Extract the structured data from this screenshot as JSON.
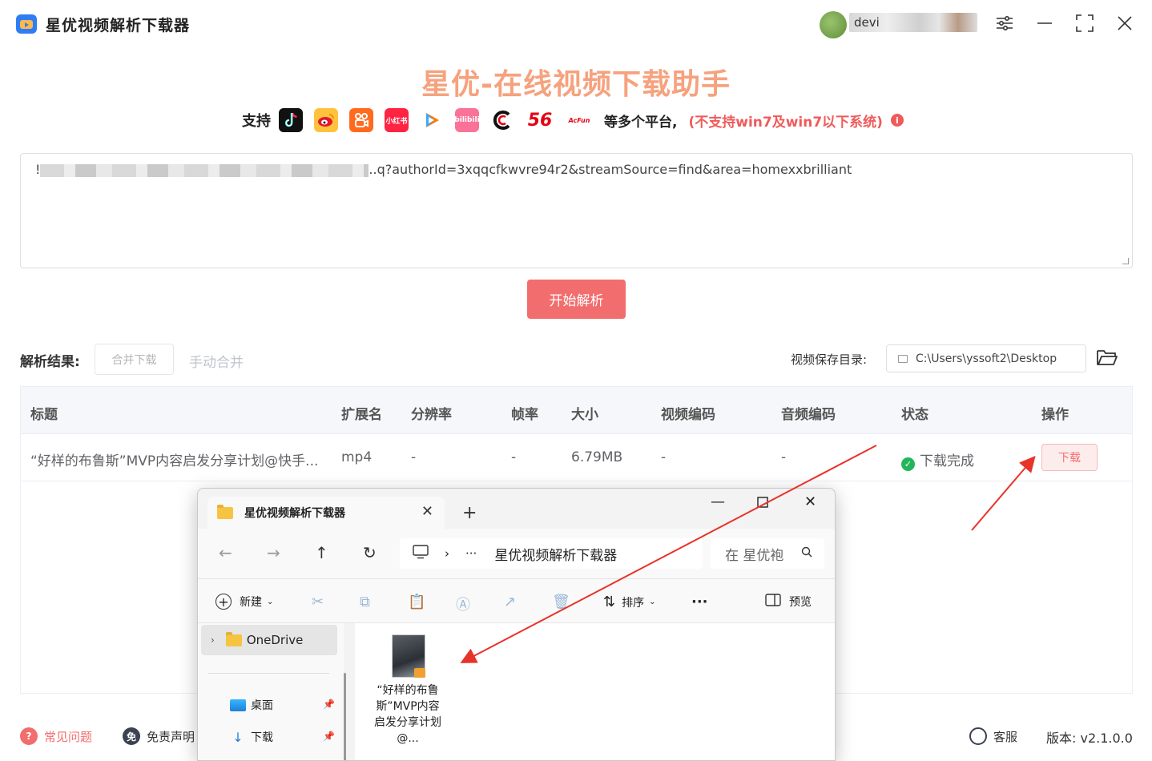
{
  "app": {
    "title": "星优视频解析下载器",
    "user_name": "devi"
  },
  "banner": {
    "title": "星优-在线视频下载助手",
    "support_label": "支持",
    "platforms": [
      "tiktok-icon",
      "weibo-icon",
      "kuaishou-icon",
      "xiaohongshu-icon",
      "tencent-video-icon",
      "bilibili-icon",
      "c-platform-icon",
      "56-icon",
      "acfun-icon"
    ],
    "platform_labels": {
      "xiaohongshu": "小红书",
      "bilibili": "bilibili",
      "fifty_six": "56",
      "acfun": "AcFun"
    },
    "more_text": "等多个平台,",
    "warning_text": "(不支持win7及win7以下系统)",
    "info_glyph": "i"
  },
  "url_input": {
    "visible_prefix": "!",
    "value_suffix": "..q?authorId=3xqqcfkwvre94r2&streamSource=find&area=homexxbrilliant"
  },
  "parse_button": "开始解析",
  "results": {
    "label": "解析结果:",
    "merge_download": "合并下载",
    "manual_merge": "手动合并",
    "save_dir_label": "视频保存目录:",
    "save_dir_value": "C:\\Users\\yssoft2\\Desktop"
  },
  "table": {
    "headers": [
      "标题",
      "扩展名",
      "分辨率",
      "帧率",
      "大小",
      "视频编码",
      "音频编码",
      "状态",
      "操作"
    ],
    "rows": [
      {
        "title": "“好样的布鲁斯”MVP内容启发分享计划@快手...",
        "ext": "mp4",
        "resolution": "-",
        "fps": "-",
        "size": "6.79MB",
        "video_codec": "-",
        "audio_codec": "-",
        "status": "下载完成",
        "action": "下载"
      }
    ]
  },
  "footer": {
    "faq": "常见问题",
    "faq_glyph": "?",
    "disclaimer": "免责声明",
    "disclaimer_glyph": "免",
    "support": "客服",
    "version": "版本: v2.1.0.0"
  },
  "explorer": {
    "tab_title": "星优视频解析下载器",
    "breadcrumb_more": "···",
    "address": "星优视频解析下载器",
    "search_placeholder": "在 星优袍",
    "cmd_new": "新建",
    "cmd_sort": "排序",
    "cmd_more": "···",
    "cmd_preview": "预览",
    "nav_onedrive": "OneDrive",
    "nav_desktop": "桌面",
    "nav_downloads": "下载",
    "file_name": "“好样的布鲁斯”MVP内容启发分享计划@..."
  },
  "colors": {
    "accent": "#f26d6d",
    "banner_title": "#f6a27e",
    "warning": "#f05a5a",
    "success": "#22b55a",
    "arrow": "#e8332a"
  }
}
